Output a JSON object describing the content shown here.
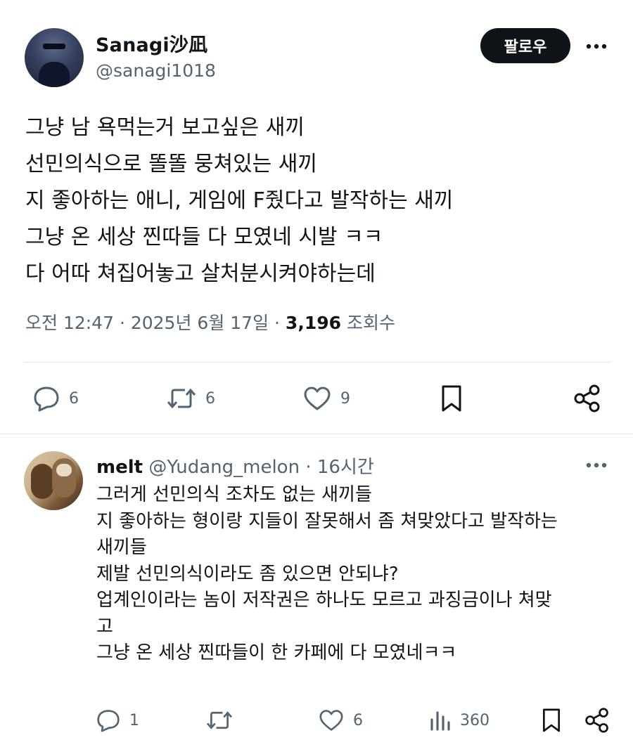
{
  "post": {
    "author": {
      "display_name": "Sanagi沙凪",
      "handle": "@sanagi1018"
    },
    "follow_label": "팔로우",
    "lines": [
      "그냥 남 욕먹는거 보고싶은 새끼",
      "선민의식으로 똘똘 뭉쳐있는 새끼",
      "지 좋아하는 애니, 게임에 F줬다고 발작하는 새끼",
      "그냥 온 세상 찐따들 다 모였네 시발 ㅋㅋ",
      "다 어따 쳐집어놓고 살처분시켜야하는데"
    ],
    "meta": {
      "time": "오전 12:47",
      "sep1": " · ",
      "date": "2025년 6월 17일",
      "sep2": " · ",
      "views": "3,196",
      "views_label": " 조회수"
    },
    "actions": {
      "replies": "6",
      "reposts": "6",
      "likes": "9"
    }
  },
  "reply": {
    "author": {
      "display_name": "melt",
      "handle": "@Yudang_melon",
      "sep": " · ",
      "time": "16시간"
    },
    "lines": [
      "그러게 선민의식 조차도 없는 새끼들",
      "지 좋아하는 형이랑 지들이 잘못해서 좀 쳐맞았다고 발작하는",
      "새끼들",
      "제발 선민의식이라도 좀 있으면 안되냐?",
      "업계인이라는 놈이 저작권은 하나도 모르고 과징금이나 쳐맞",
      "고",
      "그냥 온 세상 찐따들이 한 카페에 다 모였네ㅋㅋ"
    ],
    "actions": {
      "replies": "1",
      "reposts": "",
      "likes": "6",
      "views": "360"
    }
  },
  "icons": {
    "more": "more-horizontal-icon",
    "reply": "comment-bubble-icon",
    "repost": "repost-arrows-icon",
    "like": "heart-icon",
    "bookmark": "bookmark-icon",
    "share": "share-icon",
    "views": "analytics-bars-icon"
  },
  "colors": {
    "text": "#0f1419",
    "secondary": "#536471",
    "divider": "#e1e6ea",
    "button_bg": "#0f1419"
  }
}
